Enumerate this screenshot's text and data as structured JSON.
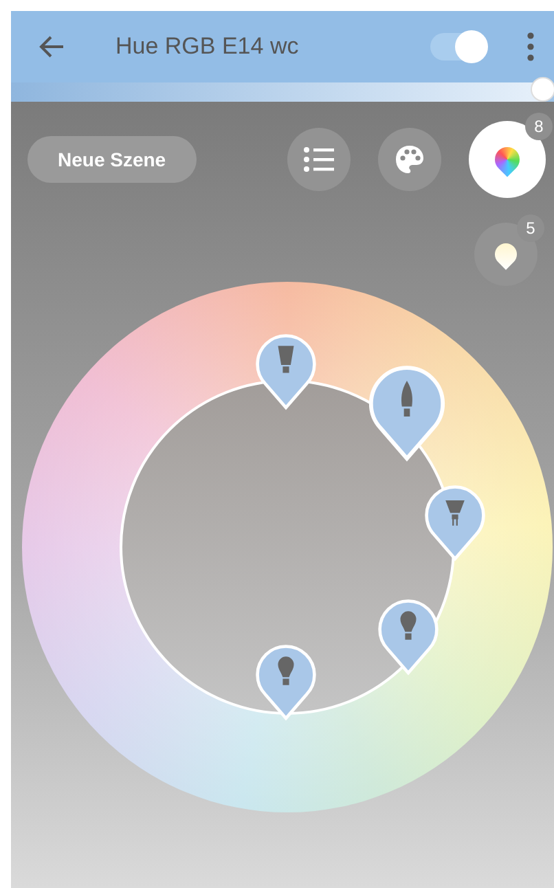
{
  "header": {
    "title": "Hue RGB E14 wc",
    "power_on": true
  },
  "brightness": {
    "level": 0.98
  },
  "scene_button": "Neue Szene",
  "modes": [
    {
      "kind": "list",
      "selected": false
    },
    {
      "kind": "palette",
      "selected": false
    },
    {
      "kind": "color",
      "selected": true,
      "count": "8"
    }
  ],
  "secondary_mode": {
    "kind": "white",
    "selected": false,
    "count": "5"
  },
  "lamps": [
    {
      "kind": "par",
      "selected": false
    },
    {
      "kind": "candle",
      "selected": true
    },
    {
      "kind": "spot",
      "selected": false
    },
    {
      "kind": "bulb",
      "selected": false
    },
    {
      "kind": "bulb",
      "selected": false
    }
  ]
}
